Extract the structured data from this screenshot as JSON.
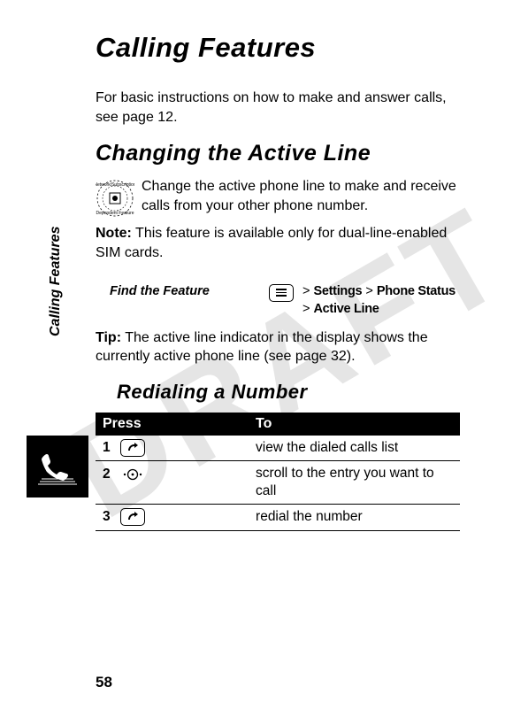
{
  "watermark": "DRAFT",
  "sidebar_label": "Calling Features",
  "page_number": "58",
  "title": "Calling Features",
  "intro": "For basic instructions on how to make and answer calls, see page 12.",
  "section1": {
    "heading": "Changing the Active Line",
    "para1": "Change the active phone line to make and receive calls from your other phone number.",
    "note_label": "Note:",
    "note_text": " This feature is available only for dual-line-enabled SIM cards.",
    "find_label": "Find the Feature",
    "crumb_line1_prefix": "> ",
    "crumb1": "Settings",
    "crumb_sep": " > ",
    "crumb2": "Phone Status",
    "crumb_line2_prefix": "> ",
    "crumb3": "Active Line",
    "tip_label": "Tip:",
    "tip_text": " The active line indicator in the display shows the currently active phone line (see page 32)."
  },
  "section2": {
    "heading": "Redialing a Number",
    "header_press": "Press",
    "header_to": "To",
    "steps": [
      {
        "num": "1",
        "to": "view the dialed calls list"
      },
      {
        "num": "2",
        "to": "scroll to the entry you want to call"
      },
      {
        "num": "3",
        "to": "redial the number"
      }
    ]
  }
}
